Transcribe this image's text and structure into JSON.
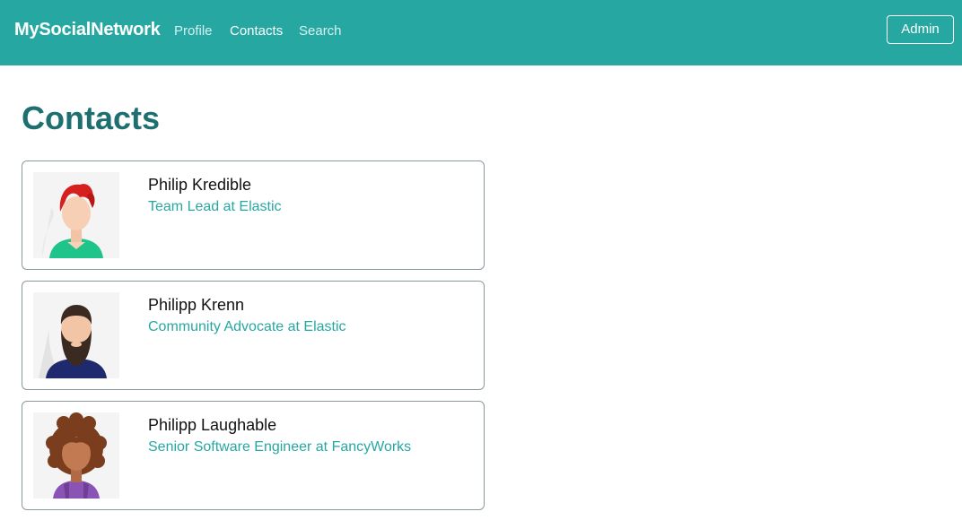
{
  "navbar": {
    "brand": "MySocialNetwork",
    "links": [
      {
        "label": "Profile",
        "active": false
      },
      {
        "label": "Contacts",
        "active": true
      },
      {
        "label": "Search",
        "active": false
      }
    ],
    "admin_label": "Admin",
    "background_color": "#27a7a2"
  },
  "page": {
    "title": "Contacts"
  },
  "contacts": [
    {
      "name": "Philip Kredible",
      "title": "Team Lead at Elastic",
      "avatar_icon": "red-haired-person-avatar"
    },
    {
      "name": "Philipp Krenn",
      "title": "Community Advocate at Elastic",
      "avatar_icon": "bearded-man-avatar"
    },
    {
      "name": "Philipp Laughable",
      "title": "Senior Software Engineer at FancyWorks",
      "avatar_icon": "curly-haired-woman-avatar"
    }
  ],
  "colors": {
    "accent": "#27a7a2",
    "title": "#1e6f70"
  }
}
